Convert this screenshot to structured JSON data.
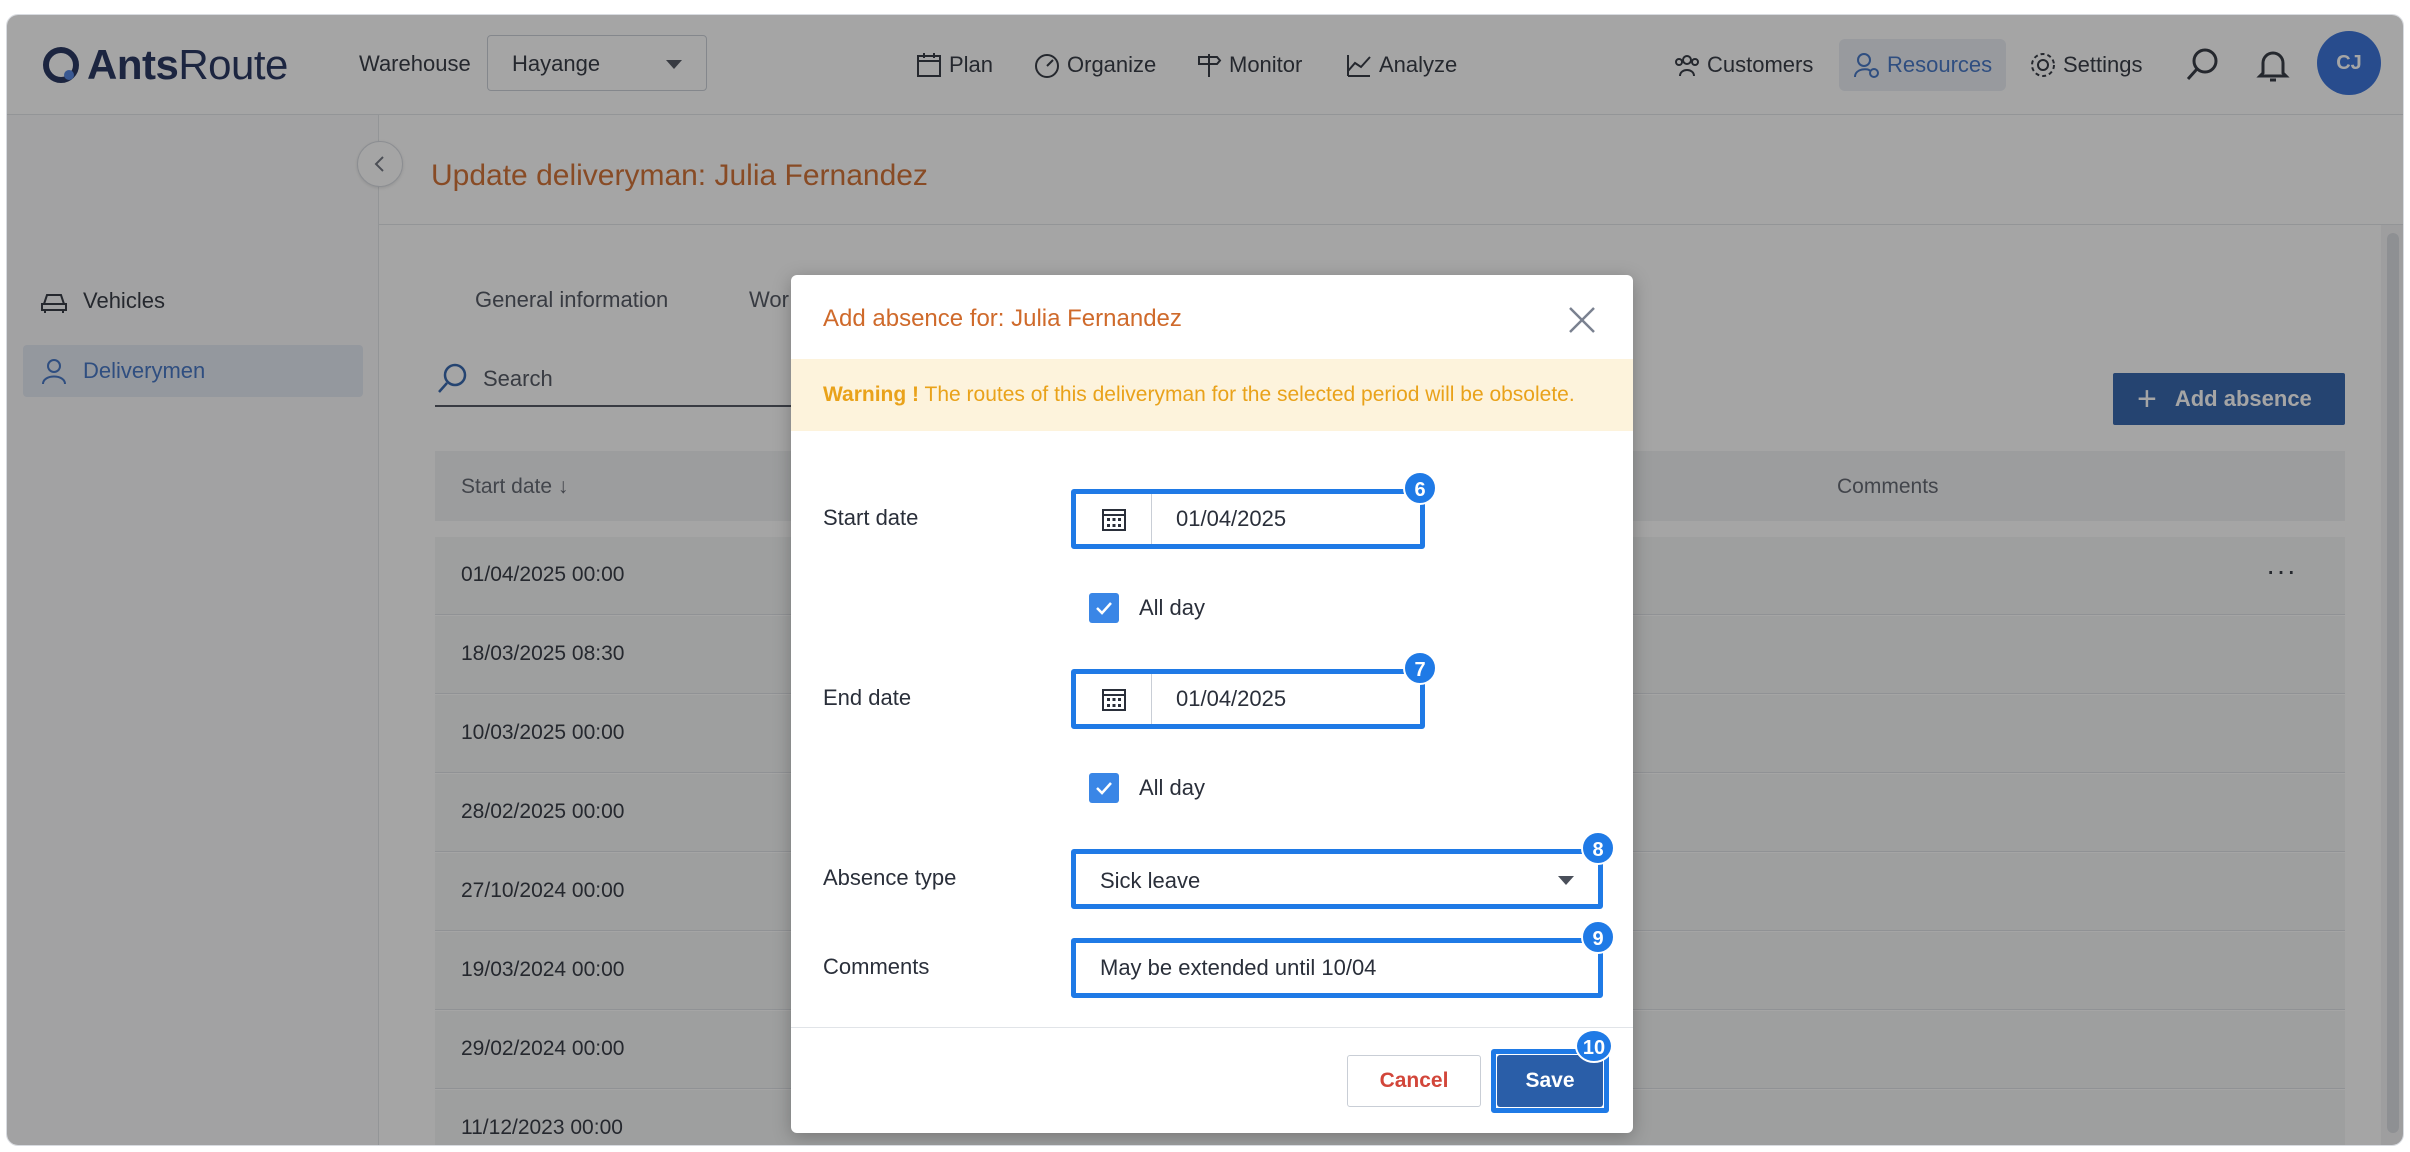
{
  "app": {
    "logo_bold": "Ants",
    "logo_light": "Route"
  },
  "warehouse": {
    "label": "Warehouse",
    "value": "Hayange"
  },
  "nav": {
    "plan": "Plan",
    "organize": "Organize",
    "monitor": "Monitor",
    "analyze": "Analyze",
    "customers": "Customers",
    "resources": "Resources",
    "settings": "Settings"
  },
  "user": {
    "initials": "CJ"
  },
  "sidebar": {
    "items": [
      {
        "label": "Vehicles"
      },
      {
        "label": "Deliverymen"
      }
    ]
  },
  "page": {
    "title": "Update deliveryman: Julia Fernandez"
  },
  "tabs": [
    "General information",
    "Wor"
  ],
  "search": {
    "placeholder": "Search"
  },
  "add_absence": {
    "label": "Add absence"
  },
  "table": {
    "columns": {
      "start_date": "Start date",
      "comments": "Comments"
    },
    "rows": [
      "01/04/2025 00:00",
      "18/03/2025 08:30",
      "10/03/2025 00:00",
      "28/02/2025 00:00",
      "27/10/2024 00:00",
      "19/03/2024 00:00",
      "29/02/2024 00:00",
      "11/12/2023 00:00"
    ],
    "row_menu": "···"
  },
  "modal": {
    "title": "Add absence for: Julia Fernandez",
    "warning_strong": "Warning !",
    "warning_text": " The routes of this deliveryman for the selected period will be obsolete.",
    "start_date_label": "Start date",
    "start_date_value": "01/04/2025",
    "start_allday_label": "All day",
    "end_date_label": "End date",
    "end_date_value": "01/04/2025",
    "end_allday_label": "All day",
    "absence_type_label": "Absence type",
    "absence_type_value": "Sick leave",
    "comments_label": "Comments",
    "comments_value": "May be extended until 10/04",
    "cancel": "Cancel",
    "save": "Save"
  },
  "callouts": {
    "start": "6",
    "end": "7",
    "type": "8",
    "comments": "9",
    "save": "10"
  },
  "colors": {
    "accent": "#2a5ea8",
    "title_orange": "#cf6a2b",
    "warning": "#e9a21a",
    "callout": "#1f7ae6"
  }
}
